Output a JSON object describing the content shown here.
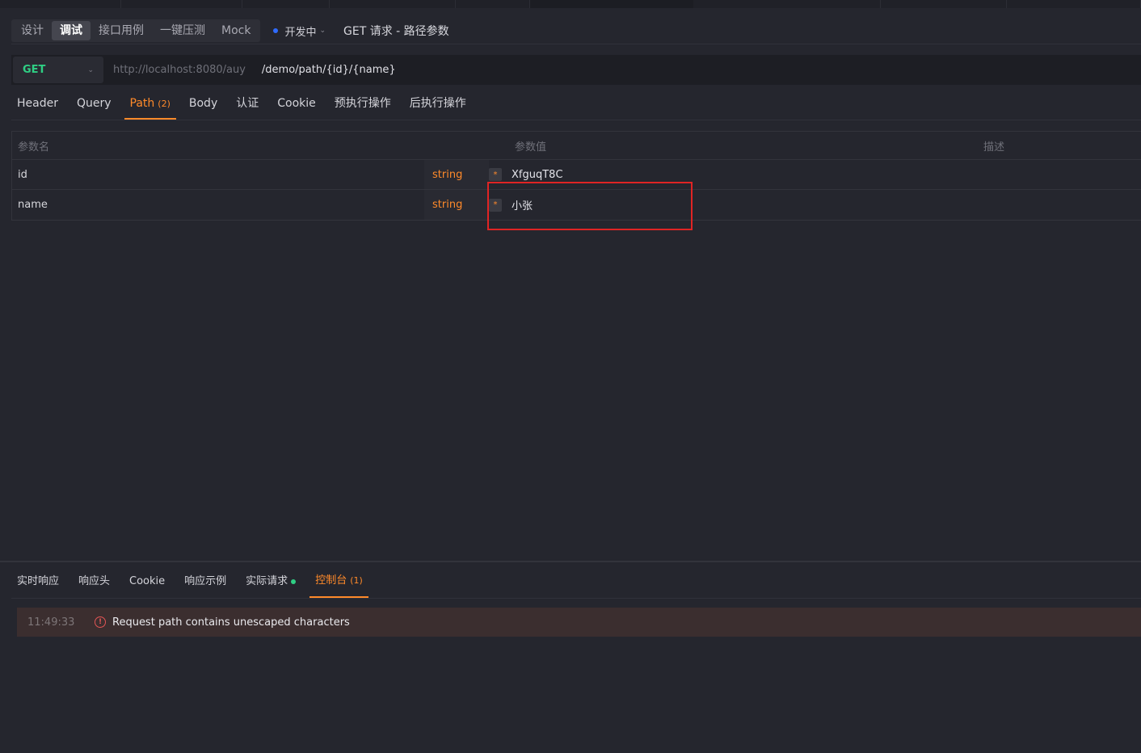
{
  "mode_tabs": [
    {
      "label": "设计",
      "active": false
    },
    {
      "label": "调试",
      "active": true
    },
    {
      "label": "接口用例",
      "active": false
    },
    {
      "label": "一键压测",
      "active": false
    },
    {
      "label": "Mock",
      "active": false
    }
  ],
  "status": {
    "label": "开发中",
    "dot_color": "#2f6bff"
  },
  "api_title": "GET 请求 - 路径参数",
  "url": {
    "method": "GET",
    "base_url": "http://localhost:8080/auy",
    "path": "/demo/path/{id}/{name}"
  },
  "request_tabs": [
    {
      "label": "Header",
      "badge": "",
      "active": false
    },
    {
      "label": "Query",
      "badge": "",
      "active": false
    },
    {
      "label": "Path",
      "badge": "(2)",
      "active": true
    },
    {
      "label": "Body",
      "badge": "",
      "active": false
    },
    {
      "label": "认证",
      "badge": "",
      "active": false
    },
    {
      "label": "Cookie",
      "badge": "",
      "active": false
    },
    {
      "label": "预执行操作",
      "badge": "",
      "active": false
    },
    {
      "label": "后执行操作",
      "badge": "",
      "active": false
    }
  ],
  "params_table": {
    "headers": {
      "name": "参数名",
      "value": "参数值",
      "desc": "描述"
    },
    "rows": [
      {
        "name": "id",
        "type": "string",
        "required_mark": "*",
        "value": "XfguqT8C",
        "desc": ""
      },
      {
        "name": "name",
        "type": "string",
        "required_mark": "*",
        "value": "小张",
        "desc": ""
      }
    ]
  },
  "response_tabs": [
    {
      "label": "实时响应",
      "badge": "",
      "active": false
    },
    {
      "label": "响应头",
      "badge": "",
      "active": false
    },
    {
      "label": "Cookie",
      "badge": "",
      "active": false
    },
    {
      "label": "响应示例",
      "badge": "",
      "active": false
    },
    {
      "label": "实际请求",
      "badge": "",
      "active": false,
      "dot": true
    },
    {
      "label": "控制台",
      "badge": "(1)",
      "active": true
    }
  ],
  "console": {
    "time": "11:49:33",
    "icon": "error-circle-icon",
    "message": "Request path contains unescaped characters"
  },
  "colors": {
    "accent": "#ff8a2a",
    "method_get": "#2fcf84",
    "error": "#e25555",
    "highlight_box": "#e02424"
  }
}
